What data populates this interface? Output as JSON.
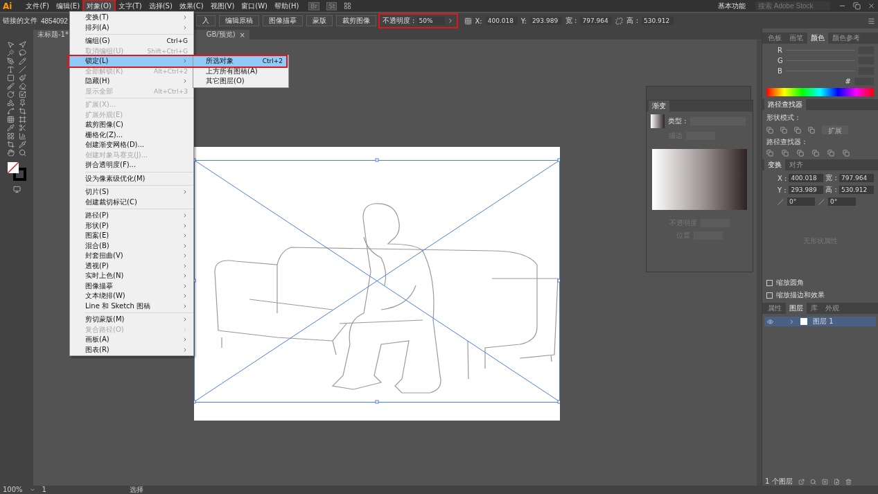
{
  "app": {
    "logo": "Ai"
  },
  "menu_bar": {
    "items": [
      {
        "label": "文件(F)",
        "selected": false
      },
      {
        "label": "编辑(E)",
        "selected": false
      },
      {
        "label": "对象(O)",
        "selected": true
      },
      {
        "label": "文字(T)",
        "selected": false
      },
      {
        "label": "选择(S)",
        "selected": false
      },
      {
        "label": "效果(C)",
        "selected": false
      },
      {
        "label": "视图(V)",
        "selected": false
      },
      {
        "label": "窗口(W)",
        "selected": false
      },
      {
        "label": "帮助(H)",
        "selected": false
      }
    ],
    "bridge": "Br",
    "stock": "St",
    "workspace": "基本功能",
    "search": {
      "placeholder": "搜索 Adobe Stock"
    }
  },
  "control_bar": {
    "object_type": "链接的文件",
    "file_name": "4854092",
    "buttons": [
      "入",
      "编辑原稿",
      "图像描摹",
      "蒙版",
      "裁剪图像"
    ],
    "opacity": {
      "label": "不透明度 :",
      "value": "50%",
      "marked": true
    },
    "fields": [
      {
        "label": "X:",
        "value": "400.018"
      },
      {
        "label": "Y:",
        "value": "293.989"
      },
      {
        "label": "宽 :",
        "value": "797.964"
      },
      {
        "label": "高 :",
        "value": "530.912"
      }
    ]
  },
  "document_tab": {
    "title": "未标题-1*",
    "title_end": "GB/预览)",
    "close": "×"
  },
  "object_menu": {
    "items": [
      {
        "kind": "item",
        "label": "变换(T)",
        "submenu": true,
        "disabled": false,
        "selected": false
      },
      {
        "kind": "item",
        "label": "排列(A)",
        "submenu": true,
        "disabled": false,
        "selected": false
      },
      {
        "kind": "separator"
      },
      {
        "kind": "item",
        "label": "编组(G)",
        "shortcut": "Ctrl+G",
        "submenu": false,
        "disabled": false,
        "selected": false
      },
      {
        "kind": "item",
        "label": "取消编组(U)",
        "shortcut": "Shift+Ctrl+G",
        "submenu": false,
        "disabled": true,
        "selected": false
      },
      {
        "kind": "item",
        "label": "锁定(L)",
        "submenu": true,
        "disabled": false,
        "selected": true
      },
      {
        "kind": "item",
        "label": "全部解锁(K)",
        "shortcut": "Alt+Ctrl+2",
        "submenu": false,
        "disabled": true,
        "selected": false
      },
      {
        "kind": "item",
        "label": "隐藏(H)",
        "submenu": true,
        "disabled": false,
        "selected": false
      },
      {
        "kind": "item",
        "label": "显示全部",
        "shortcut": "Alt+Ctrl+3",
        "submenu": false,
        "disabled": true,
        "selected": false
      },
      {
        "kind": "separator"
      },
      {
        "kind": "item",
        "label": "扩展(X)...",
        "submenu": false,
        "disabled": true,
        "selected": false
      },
      {
        "kind": "item",
        "label": "扩展外观(E)",
        "submenu": false,
        "disabled": true,
        "selected": false
      },
      {
        "kind": "item",
        "label": "裁剪图像(C)",
        "submenu": false,
        "disabled": false,
        "selected": false
      },
      {
        "kind": "item",
        "label": "栅格化(Z)...",
        "submenu": false,
        "disabled": false,
        "selected": false
      },
      {
        "kind": "item",
        "label": "创建渐变网格(D)...",
        "submenu": false,
        "disabled": false,
        "selected": false
      },
      {
        "kind": "item",
        "label": "创建对象马赛克(J)...",
        "submenu": false,
        "disabled": true,
        "selected": false
      },
      {
        "kind": "item",
        "label": "拼合透明度(F)...",
        "submenu": false,
        "disabled": false,
        "selected": false
      },
      {
        "kind": "separator"
      },
      {
        "kind": "item",
        "label": "设为像素级优化(M)",
        "submenu": false,
        "disabled": false,
        "selected": false
      },
      {
        "kind": "separator"
      },
      {
        "kind": "item",
        "label": "切片(S)",
        "submenu": true,
        "disabled": false,
        "selected": false
      },
      {
        "kind": "item",
        "label": "创建裁切标记(C)",
        "submenu": false,
        "disabled": false,
        "selected": false
      },
      {
        "kind": "separator"
      },
      {
        "kind": "item",
        "label": "路径(P)",
        "submenu": true,
        "disabled": false,
        "selected": false
      },
      {
        "kind": "item",
        "label": "形状(P)",
        "submenu": true,
        "disabled": false,
        "selected": false
      },
      {
        "kind": "item",
        "label": "图案(E)",
        "submenu": true,
        "disabled": false,
        "selected": false
      },
      {
        "kind": "item",
        "label": "混合(B)",
        "submenu": true,
        "disabled": false,
        "selected": false
      },
      {
        "kind": "item",
        "label": "封套扭曲(V)",
        "submenu": true,
        "disabled": false,
        "selected": false
      },
      {
        "kind": "item",
        "label": "透视(P)",
        "submenu": true,
        "disabled": false,
        "selected": false
      },
      {
        "kind": "item",
        "label": "实时上色(N)",
        "submenu": true,
        "disabled": false,
        "selected": false
      },
      {
        "kind": "item",
        "label": "图像描摹",
        "submenu": true,
        "disabled": false,
        "selected": false
      },
      {
        "kind": "item",
        "label": "文本绕排(W)",
        "submenu": true,
        "disabled": false,
        "selected": false
      },
      {
        "kind": "item",
        "label": "Line 和 Sketch 图稿",
        "submenu": true,
        "disabled": false,
        "selected": false
      },
      {
        "kind": "separator"
      },
      {
        "kind": "item",
        "label": "剪切蒙版(M)",
        "submenu": true,
        "disabled": false,
        "selected": false
      },
      {
        "kind": "item",
        "label": "复合路径(O)",
        "submenu": true,
        "disabled": true,
        "selected": false
      },
      {
        "kind": "item",
        "label": "画板(A)",
        "submenu": true,
        "disabled": false,
        "selected": false
      },
      {
        "kind": "item",
        "label": "图表(R)",
        "submenu": true,
        "disabled": false,
        "selected": false
      }
    ]
  },
  "lock_submenu": {
    "items": [
      {
        "label": "所选对象",
        "shortcut": "Ctrl+2",
        "selected": true
      },
      {
        "label": "上方所有图稿(A)",
        "selected": false
      },
      {
        "label": "其它图层(O)",
        "selected": false
      }
    ]
  },
  "gradient_panel": {
    "title": "渐变",
    "type_label": "类型 :",
    "stroke_label": "描边",
    "opacity_label": "不透明度",
    "position_label": "位置"
  },
  "color_panel": {
    "tabs": [
      {
        "label": "色板",
        "selected": false
      },
      {
        "label": "画笔",
        "selected": false
      },
      {
        "label": "颜色",
        "selected": true
      },
      {
        "label": "颜色参考",
        "selected": false
      }
    ],
    "channels": [
      "R",
      "G",
      "B"
    ],
    "hex_label": "#"
  },
  "pathfinder_panel": {
    "title": "路径查找器",
    "shape_modes_label": "形状模式 :",
    "expand_button": "扩展",
    "pathfinders_label": "路径查找器 :"
  },
  "transform_panel": {
    "tabs": [
      {
        "label": "变换",
        "selected": true
      },
      {
        "label": "对齐",
        "selected": false
      }
    ],
    "fields": [
      {
        "label": "X :",
        "value": "400.018"
      },
      {
        "label": "宽 :",
        "value": "797.964"
      },
      {
        "label": "Y :",
        "value": "293.989"
      },
      {
        "label": "高 :",
        "value": "530.912"
      }
    ],
    "angle": "0°",
    "shear": "0°",
    "empty_note": "无形状属性",
    "options": [
      {
        "label": "缩放圆角",
        "checked": false
      },
      {
        "label": "缩放描边和效果",
        "checked": false
      }
    ]
  },
  "layers_panel": {
    "tabs": [
      {
        "label": "属性",
        "selected": false
      },
      {
        "label": "图层",
        "selected": true
      },
      {
        "label": "库",
        "selected": false
      },
      {
        "label": "外观",
        "selected": false
      }
    ],
    "layers": [
      {
        "name": "图层 1",
        "selected": true
      }
    ],
    "footer": "1 个图层"
  },
  "status_bar": {
    "zoom": "100%",
    "artboard": "1",
    "tool": "选择"
  }
}
